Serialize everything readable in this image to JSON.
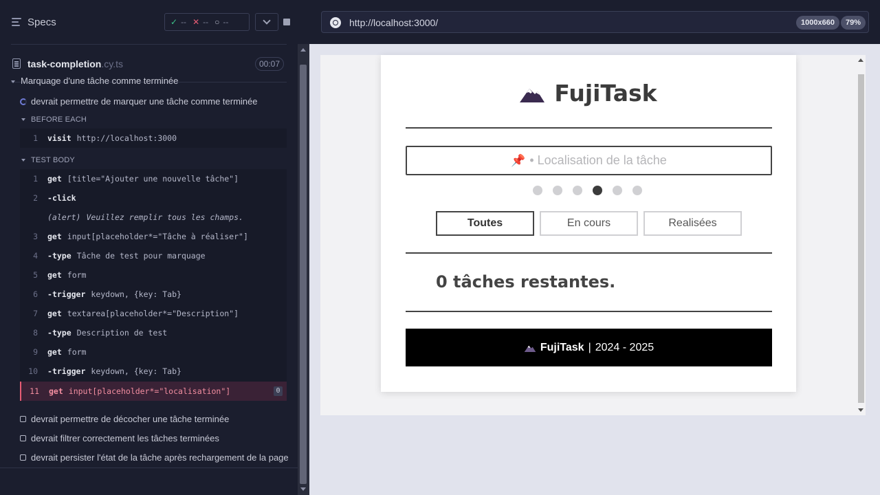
{
  "reporter": {
    "specs_title": "Specs",
    "stats": {
      "passed": "--",
      "failed": "--",
      "pending": "--"
    },
    "file": {
      "name": "task-completion",
      "ext": ".cy.ts",
      "duration": "00:07"
    },
    "suite_title": "Marquage d'une tâche comme terminée",
    "current_test": "devrait permettre de marquer une tâche comme terminée",
    "before_each_label": "BEFORE EACH",
    "before_each": [
      {
        "num": "1",
        "name": "visit",
        "msg": "http://localhost:3000"
      }
    ],
    "test_body_label": "TEST BODY",
    "commands": [
      {
        "num": "1",
        "name": "get",
        "msg": "[title=\"Ajouter une nouvelle tâche\"]"
      },
      {
        "num": "2",
        "name": "click",
        "msg": ""
      },
      {
        "num": "",
        "name": "(alert)",
        "msg": "Veuillez remplir tous les champs."
      },
      {
        "num": "3",
        "name": "get",
        "msg": "input[placeholder*=\"Tâche à réaliser\"]"
      },
      {
        "num": "4",
        "name": "type",
        "msg": "Tâche de test pour marquage"
      },
      {
        "num": "5",
        "name": "get",
        "msg": "form"
      },
      {
        "num": "6",
        "name": "trigger",
        "msg": "keydown, {key: Tab}"
      },
      {
        "num": "7",
        "name": "get",
        "msg": "textarea[placeholder*=\"Description\"]"
      },
      {
        "num": "8",
        "name": "type",
        "msg": "Description de test"
      },
      {
        "num": "9",
        "name": "get",
        "msg": "form"
      },
      {
        "num": "10",
        "name": "trigger",
        "msg": "keydown, {key: Tab}"
      },
      {
        "num": "11",
        "name": "get",
        "msg": "input[placeholder*=\"localisation\"]",
        "badge": "0"
      }
    ],
    "pending_tests": [
      "devrait permettre de décocher une tâche terminée",
      "devrait filtrer correctement les tâches terminées",
      "devrait persister l'état de la tâche après rechargement de la page"
    ]
  },
  "browser": {
    "url": "http://localhost:3000/",
    "viewport": "1000x660",
    "zoom": "79%"
  },
  "app": {
    "title": "FujiTask",
    "location_placeholder": "• Localisation de la tâche",
    "step_dots": 6,
    "active_step": 4,
    "filters": [
      "Toutes",
      "En cours",
      "Realisées"
    ],
    "active_filter": "Toutes",
    "remaining": "0 tâches restantes.",
    "footer_brand": "FujiTask",
    "footer_years": "2024 - 2025"
  },
  "colors": {
    "reporter_bg": "#1b1e2e",
    "failed_accent": "#e85c74",
    "passed_accent": "#3cc48a",
    "running_accent": "#6f7bd6"
  }
}
